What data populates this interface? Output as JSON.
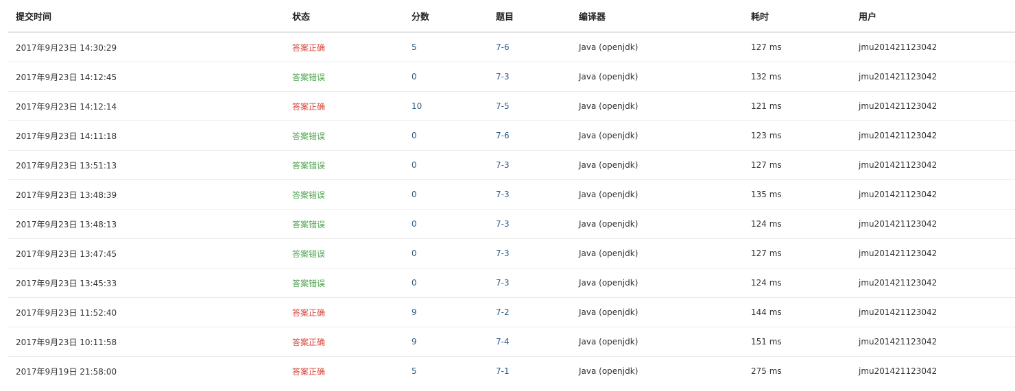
{
  "table": {
    "headers": {
      "submit_time": "提交时间",
      "status": "状态",
      "score": "分数",
      "problem": "题目",
      "compiler": "编译器",
      "time_cost": "耗时",
      "user": "用户"
    },
    "rows": [
      {
        "submit_time": "2017年9月23日 14:30:29",
        "status": "答案正确",
        "score": "5",
        "problem": "7-6",
        "compiler": "Java (openjdk)",
        "time_cost": "127 ms",
        "user": "jmu201421123042"
      },
      {
        "submit_time": "2017年9月23日 14:12:45",
        "status": "答案错误",
        "score": "0",
        "problem": "7-3",
        "compiler": "Java (openjdk)",
        "time_cost": "132 ms",
        "user": "jmu201421123042"
      },
      {
        "submit_time": "2017年9月23日 14:12:14",
        "status": "答案正确",
        "score": "10",
        "problem": "7-5",
        "compiler": "Java (openjdk)",
        "time_cost": "121 ms",
        "user": "jmu201421123042"
      },
      {
        "submit_time": "2017年9月23日 14:11:18",
        "status": "答案错误",
        "score": "0",
        "problem": "7-6",
        "compiler": "Java (openjdk)",
        "time_cost": "123 ms",
        "user": "jmu201421123042"
      },
      {
        "submit_time": "2017年9月23日 13:51:13",
        "status": "答案错误",
        "score": "0",
        "problem": "7-3",
        "compiler": "Java (openjdk)",
        "time_cost": "127 ms",
        "user": "jmu201421123042"
      },
      {
        "submit_time": "2017年9月23日 13:48:39",
        "status": "答案错误",
        "score": "0",
        "problem": "7-3",
        "compiler": "Java (openjdk)",
        "time_cost": "135 ms",
        "user": "jmu201421123042"
      },
      {
        "submit_time": "2017年9月23日 13:48:13",
        "status": "答案错误",
        "score": "0",
        "problem": "7-3",
        "compiler": "Java (openjdk)",
        "time_cost": "124 ms",
        "user": "jmu201421123042"
      },
      {
        "submit_time": "2017年9月23日 13:47:45",
        "status": "答案错误",
        "score": "0",
        "problem": "7-3",
        "compiler": "Java (openjdk)",
        "time_cost": "127 ms",
        "user": "jmu201421123042"
      },
      {
        "submit_time": "2017年9月23日 13:45:33",
        "status": "答案错误",
        "score": "0",
        "problem": "7-3",
        "compiler": "Java (openjdk)",
        "time_cost": "124 ms",
        "user": "jmu201421123042"
      },
      {
        "submit_time": "2017年9月23日 11:52:40",
        "status": "答案正确",
        "score": "9",
        "problem": "7-2",
        "compiler": "Java (openjdk)",
        "time_cost": "144 ms",
        "user": "jmu201421123042"
      },
      {
        "submit_time": "2017年9月23日 10:11:58",
        "status": "答案正确",
        "score": "9",
        "problem": "7-4",
        "compiler": "Java (openjdk)",
        "time_cost": "151 ms",
        "user": "jmu201421123042"
      },
      {
        "submit_time": "2017年9月19日 21:58:00",
        "status": "答案正确",
        "score": "5",
        "problem": "7-1",
        "compiler": "Java (openjdk)",
        "time_cost": "275 ms",
        "user": "jmu201421123042"
      }
    ]
  },
  "colors": {
    "accepted": "#d9453a",
    "wrong": "#4ea34f",
    "link": "#2b5b8a"
  }
}
